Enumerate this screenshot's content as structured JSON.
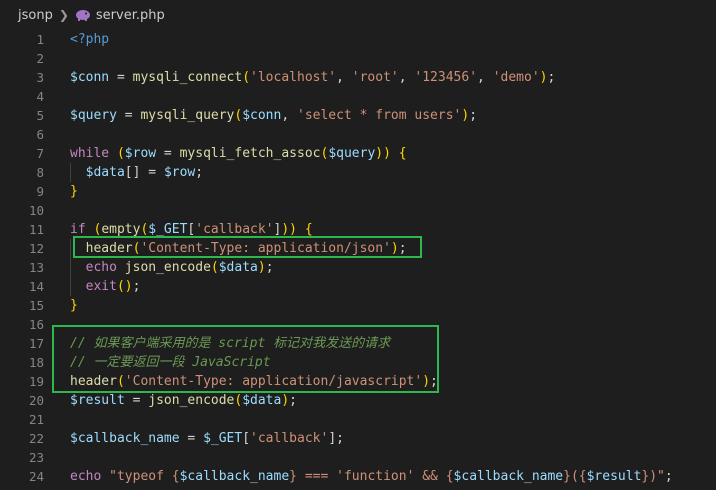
{
  "breadcrumb": {
    "folder": "jsonp",
    "file": "server.php"
  },
  "colors": {
    "highlight_box": "#2eb84b",
    "background": "#1e1e1e"
  },
  "lines": [
    {
      "n": "1",
      "tokens": [
        [
          "t",
          "<?php"
        ]
      ]
    },
    {
      "n": "2",
      "tokens": []
    },
    {
      "n": "3",
      "tokens": [
        [
          "v",
          "$conn"
        ],
        [
          "p",
          " = "
        ],
        [
          "f",
          "mysqli_connect"
        ],
        [
          "y",
          "("
        ],
        [
          "s",
          "'localhost'"
        ],
        [
          "p",
          ", "
        ],
        [
          "s",
          "'root'"
        ],
        [
          "p",
          ", "
        ],
        [
          "s",
          "'123456'"
        ],
        [
          "p",
          ", "
        ],
        [
          "s",
          "'demo'"
        ],
        [
          "y",
          ")"
        ],
        [
          "p",
          ";"
        ]
      ]
    },
    {
      "n": "4",
      "tokens": []
    },
    {
      "n": "5",
      "tokens": [
        [
          "v",
          "$query"
        ],
        [
          "p",
          " = "
        ],
        [
          "f",
          "mysqli_query"
        ],
        [
          "y",
          "("
        ],
        [
          "v",
          "$conn"
        ],
        [
          "p",
          ", "
        ],
        [
          "s",
          "'select * from users'"
        ],
        [
          "y",
          ")"
        ],
        [
          "p",
          ";"
        ]
      ]
    },
    {
      "n": "6",
      "tokens": []
    },
    {
      "n": "7",
      "tokens": [
        [
          "k",
          "while"
        ],
        [
          "p",
          " "
        ],
        [
          "y",
          "("
        ],
        [
          "v",
          "$row"
        ],
        [
          "p",
          " = "
        ],
        [
          "f",
          "mysqli_fetch_assoc"
        ],
        [
          "y",
          "("
        ],
        [
          "v",
          "$query"
        ],
        [
          "y",
          "))"
        ],
        [
          "p",
          " "
        ],
        [
          "y",
          "{"
        ]
      ]
    },
    {
      "n": "8",
      "tokens": [
        [
          "p",
          "  "
        ],
        [
          "v",
          "$data"
        ],
        [
          "p",
          "[] = "
        ],
        [
          "v",
          "$row"
        ],
        [
          "p",
          ";"
        ]
      ]
    },
    {
      "n": "9",
      "tokens": [
        [
          "y",
          "}"
        ]
      ]
    },
    {
      "n": "10",
      "tokens": []
    },
    {
      "n": "11",
      "tokens": [
        [
          "k",
          "if"
        ],
        [
          "p",
          " "
        ],
        [
          "y",
          "("
        ],
        [
          "f",
          "empty"
        ],
        [
          "y",
          "("
        ],
        [
          "v",
          "$_GET"
        ],
        [
          "p",
          "["
        ],
        [
          "s",
          "'callback'"
        ],
        [
          "p",
          "]"
        ],
        [
          "y",
          "))"
        ],
        [
          "p",
          " "
        ],
        [
          "y",
          "{"
        ]
      ]
    },
    {
      "n": "12",
      "tokens": [
        [
          "p",
          "  "
        ],
        [
          "f",
          "header"
        ],
        [
          "y",
          "("
        ],
        [
          "s",
          "'Content-Type: application/json'"
        ],
        [
          "y",
          ")"
        ],
        [
          "p",
          ";"
        ]
      ]
    },
    {
      "n": "13",
      "tokens": [
        [
          "p",
          "  "
        ],
        [
          "k",
          "echo"
        ],
        [
          "p",
          " "
        ],
        [
          "f",
          "json_encode"
        ],
        [
          "y",
          "("
        ],
        [
          "v",
          "$data"
        ],
        [
          "y",
          ")"
        ],
        [
          "p",
          ";"
        ]
      ]
    },
    {
      "n": "14",
      "tokens": [
        [
          "p",
          "  "
        ],
        [
          "k",
          "exit"
        ],
        [
          "y",
          "()"
        ],
        [
          "p",
          ";"
        ]
      ]
    },
    {
      "n": "15",
      "tokens": [
        [
          "y",
          "}"
        ]
      ]
    },
    {
      "n": "16",
      "tokens": []
    },
    {
      "n": "17",
      "tokens": [
        [
          "c",
          "// 如果客户端采用的是 script 标记对我发送的请求"
        ]
      ]
    },
    {
      "n": "18",
      "tokens": [
        [
          "c",
          "// 一定要返回一段 JavaScript"
        ]
      ]
    },
    {
      "n": "19",
      "tokens": [
        [
          "f",
          "header"
        ],
        [
          "y",
          "("
        ],
        [
          "s",
          "'Content-Type: application/javascript'"
        ],
        [
          "y",
          ")"
        ],
        [
          "p",
          ";"
        ]
      ]
    },
    {
      "n": "20",
      "tokens": [
        [
          "v",
          "$result"
        ],
        [
          "p",
          " = "
        ],
        [
          "f",
          "json_encode"
        ],
        [
          "y",
          "("
        ],
        [
          "v",
          "$data"
        ],
        [
          "y",
          ")"
        ],
        [
          "p",
          ";"
        ]
      ]
    },
    {
      "n": "21",
      "tokens": []
    },
    {
      "n": "22",
      "tokens": [
        [
          "v",
          "$callback_name"
        ],
        [
          "p",
          " = "
        ],
        [
          "v",
          "$_GET"
        ],
        [
          "p",
          "["
        ],
        [
          "s",
          "'callback'"
        ],
        [
          "p",
          "]"
        ],
        [
          "p",
          ";"
        ]
      ]
    },
    {
      "n": "23",
      "tokens": []
    },
    {
      "n": "24",
      "tokens": [
        [
          "k",
          "echo"
        ],
        [
          "p",
          " "
        ],
        [
          "s",
          "\"typeof {"
        ],
        [
          "v",
          "$callback_name"
        ],
        [
          "s",
          "} === 'function' && {"
        ],
        [
          "v",
          "$callback_name"
        ],
        [
          "s",
          "}({"
        ],
        [
          "v",
          "$result"
        ],
        [
          "s",
          "})\""
        ],
        [
          "p",
          ";"
        ]
      ]
    }
  ]
}
